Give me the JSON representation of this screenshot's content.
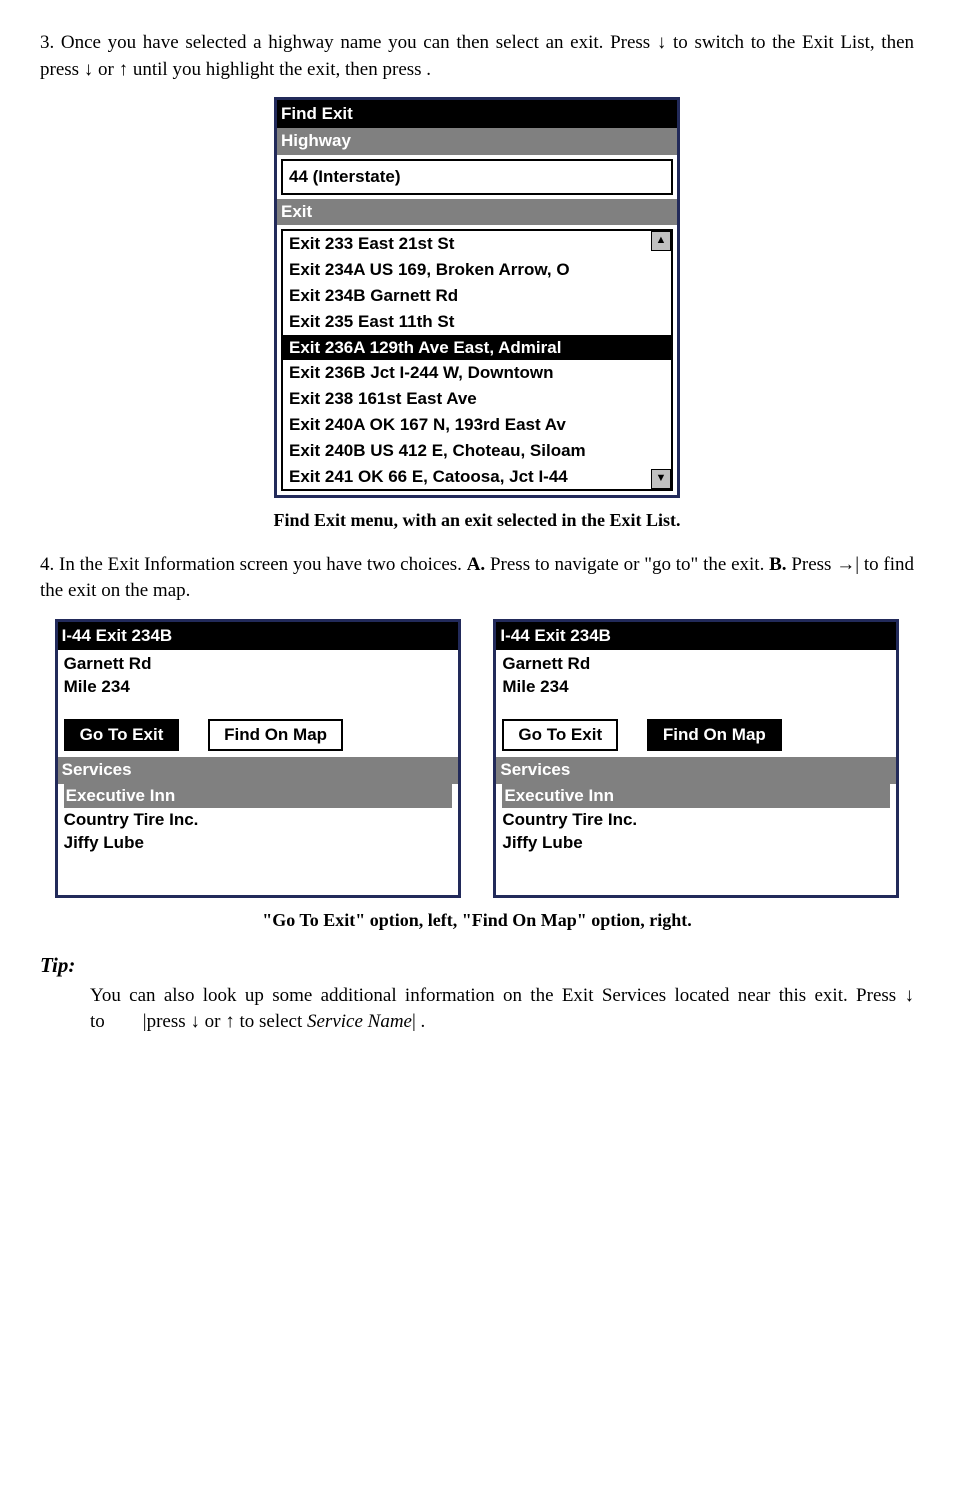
{
  "step3": "3. Once you have selected a highway name you can then select an exit. Press ↓ to switch to the Exit List, then press ↓ or ↑ until you highlight the exit, then press     .",
  "findExit": {
    "title": "Find Exit",
    "highwayLabel": "Highway",
    "highwayValue": "44 (Interstate)",
    "exitLabel": "Exit",
    "items": [
      "Exit 233 East 21st St",
      "Exit 234A US 169, Broken Arrow, O",
      "Exit 234B Garnett Rd",
      "Exit 235 East 11th St",
      "Exit 236A 129th Ave East, Admiral",
      "Exit 236B Jct I-244 W, Downtown",
      "Exit 238 161st East Ave",
      "Exit 240A OK 167 N, 193rd East Av",
      "Exit 240B US 412 E, Choteau, Siloam",
      "Exit 241 OK 66 E, Catoosa, Jct I-44"
    ],
    "selectedIndex": 4
  },
  "caption1": "Find Exit menu, with an exit selected in the Exit List.",
  "step4_a": "4. In the Exit Information screen you have two choices. ",
  "step4_b": " Press        to navigate or \"go to\" the exit. ",
  "step4_c": " Press →|       to find the exit on the map.",
  "label_A": "A.",
  "label_B": "B.",
  "exitInfo": {
    "title": "I-44 Exit 234B",
    "line1": "Garnett Rd",
    "line2": "Mile 234",
    "btnGoTo": "Go To Exit",
    "btnFind": "Find On Map",
    "servicesLabel": "Services",
    "svcHeader": "Executive Inn",
    "svc1": "Country Tire Inc.",
    "svc2": "Jiffy Lube"
  },
  "caption2": "\"Go To Exit\" option, left, \"Find On Map\" option, right.",
  "tipLabel": "Tip:",
  "tip_a": "You can also look up some additional information on the Exit Services located near this exit. Press ↓ to",
  "tip_b": "|press ↓ or ↑ to select ",
  "tip_svc": "Service Name",
  "tip_c": "|      ."
}
